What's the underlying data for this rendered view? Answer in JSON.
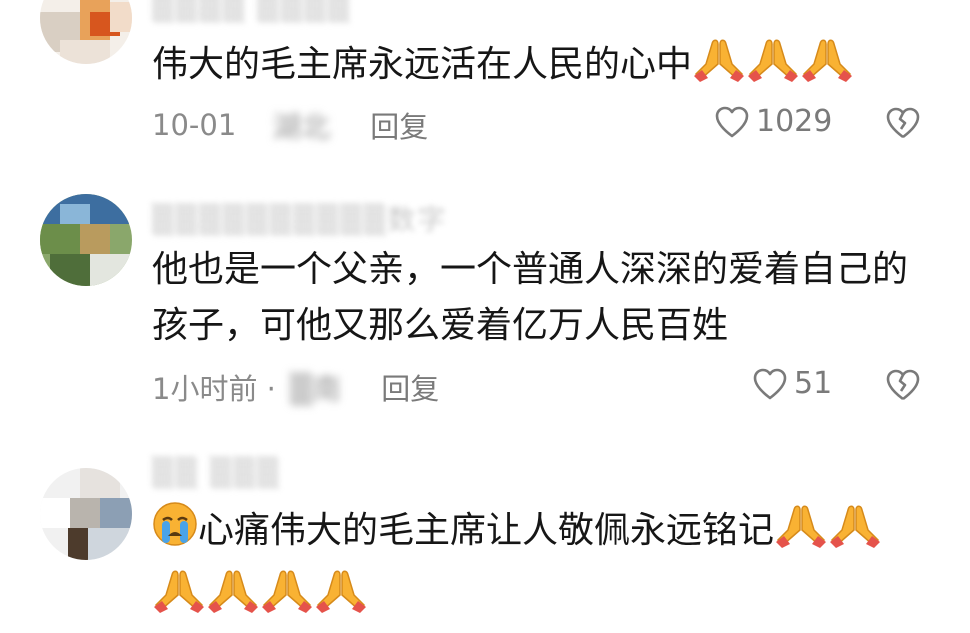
{
  "comments": [
    {
      "username": "▒▒▒▒ ▒▒▒▒",
      "text_lines": [
        "伟大的毛主席永远活在人民的心中"
      ],
      "trailing_emojis": [
        "folded-hands",
        "folded-hands",
        "folded-hands"
      ],
      "time": "10-01",
      "location": "湖北",
      "reply_label": "回复",
      "likes": "1029"
    },
    {
      "username": "▒▒▒▒▒▒▒▒▒▒数字",
      "text_lines": [
        "他也是一个父亲，一个普通人深深的爱着自己的",
        "孩子，可他又那么爱着亿万人民百姓"
      ],
      "time": "1小时前 ·",
      "location": "▒南",
      "reply_label": "回复",
      "likes": "51"
    },
    {
      "username": "▒▒ ▒▒▒",
      "text_lines": [
        "心痛伟大的毛主席让人敬佩永远铭记"
      ],
      "leading_emoji": "crying-face",
      "trailing_emojis": [
        "folded-hands",
        "folded-hands"
      ],
      "second_line_emojis": [
        "folded-hands",
        "folded-hands",
        "folded-hands",
        "folded-hands"
      ]
    }
  ],
  "colors": {
    "text": "#161616",
    "meta": "#8a8a8a",
    "emoji_yellow": "#f9b233",
    "emoji_cuff": "#e5534b"
  }
}
